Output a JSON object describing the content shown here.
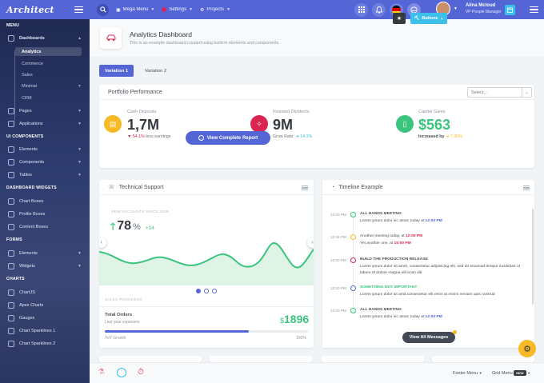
{
  "header": {
    "logo": "Architect",
    "nav": [
      {
        "label": "Mega Menu"
      },
      {
        "label": "Settings"
      },
      {
        "label": "Projects"
      }
    ],
    "user": {
      "name": "Alina Mcloud",
      "role": "VP People Manager"
    }
  },
  "sidebar": {
    "sections": [
      {
        "title": "MENU"
      },
      {
        "title": "UI COMPONENTS"
      },
      {
        "title": "DASHBOARD WIDGETS"
      },
      {
        "title": "FORMS"
      },
      {
        "title": "CHARTS"
      }
    ],
    "dashboards": "Dashboards",
    "dash_sub": [
      "Analytics",
      "Commerce",
      "Sales",
      "Minimal",
      "CRM"
    ],
    "pages": "Pages",
    "applications": "Applications",
    "ui": [
      "Elements",
      "Components",
      "Tables"
    ],
    "widgets": [
      "Chart Boxes",
      "Profile Boxes",
      "Content Boxes"
    ],
    "forms": [
      "Elements",
      "Widgets"
    ],
    "charts": [
      "ChartJS",
      "Apex Charts",
      "Gauges",
      "Chart Sparklines 1",
      "Chart Sparklines 2"
    ]
  },
  "page": {
    "title": "Analytics Dashboard",
    "subtitle": "This is an example dashboard created using build-in elements and components.",
    "buttons_label": "Buttons"
  },
  "tabs": [
    "Variation 1",
    "Variation 2"
  ],
  "portfolio": {
    "title": "Portfolio Performance",
    "select_placeholder": "Select...",
    "stats": [
      {
        "label": "Cash Deposits",
        "value": "1,7M",
        "note_value": "54.1%",
        "note_text": "less earnings",
        "color": "#f7b924"
      },
      {
        "label": "Invested Dividents",
        "value": "9M",
        "note_text": "Grow Rate:",
        "note_value": "14.1%",
        "color": "#d92550"
      },
      {
        "label": "Capital Gains",
        "value": "$563",
        "note_text": "Increased by",
        "note_value": "7.35%",
        "color": "#3ac47d"
      }
    ],
    "report_button": "View Complete Report"
  },
  "support": {
    "title": "Technical Support",
    "new_accounts_label": "NEW ACCOUNTS SINCE 2018",
    "value": "78",
    "unit": "%",
    "delta": "+14",
    "sales_label": "SALES PROGRESS",
    "total_orders": "Total Orders",
    "expenses": "Last year expenses",
    "amount": "1896",
    "currency": "$",
    "progress": 0.71,
    "growth_label": "YoY Growth",
    "growth_value": "100%"
  },
  "timeline": {
    "title": "Timeline Example",
    "items": [
      {
        "time": "12:00 PM",
        "title": "ALL HANDS MEETING",
        "color": "#3ac47d",
        "line1": "Lorem ipsum dolor sic amet, today at",
        "hl": "12:00 PM"
      },
      {
        "time": "12:25 PM",
        "text": "Another meeting today, at",
        "hl": "12:00 PM",
        "color": "#f7b924",
        "line2": "Yet another one, at",
        "hl2": "15:00 PM"
      },
      {
        "time": "12:00 PM",
        "title": "BUILD THE PRODUCTION RELEASE",
        "color": "#d92550",
        "line1": "Lorem ipsum dolor sit amet, consectetur adipisicing elit, sed do eiusmod tempor incididunt ut labore et dolore magna elit enim elit"
      },
      {
        "time": "12:00 PM",
        "title": "SOMETHING NOT IMPORTANT",
        "color": "#5466d6",
        "line1": "Lorem ipsum dolor sit amit,consectetur elit enim at minim veniam quis nostrud"
      },
      {
        "time": "12:00 PM",
        "title": "ALL HANDS MEETING",
        "color": "#3ac47d",
        "line1": "Lorem ipsum dolor sic amet, today at",
        "hl": "12:00 PM"
      }
    ],
    "view_all": "View All Messages"
  },
  "footer": {
    "footer_menu": "Footer Menu",
    "grid_menu": "Grid Menu",
    "badge": "NEW"
  },
  "colors": {
    "primary": "#5466d6",
    "success": "#3ac47d",
    "warning": "#f7b924",
    "danger": "#d92550",
    "info": "#3ac0ea"
  }
}
